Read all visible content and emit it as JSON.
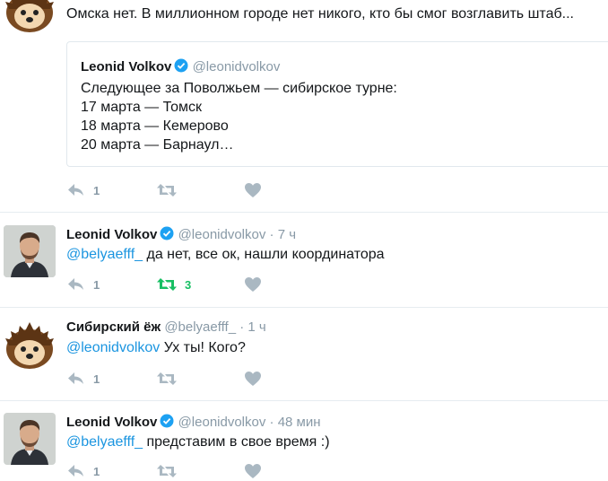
{
  "tweets": [
    {
      "text": "Омска нет. В миллионном городе нет никого, кто бы смог возглавить штаб...",
      "quote": {
        "name": "Leonid Volkov",
        "handle": "@leonidvolkov",
        "lines": [
          "Следующее за Поволжьем — сибирское турне:",
          "17 марта — Томск",
          "18 марта — Кемерово",
          "20 марта — Барнаул…"
        ]
      },
      "reply_count": "1",
      "retweet_count": "",
      "retweeted": false
    },
    {
      "name": "Leonid Volkov",
      "handle": "@leonidvolkov",
      "time": "· 7 ч",
      "mention": "@belyaefff_",
      "text": " да нет, все ок, нашли координатора",
      "reply_count": "1",
      "retweet_count": "3",
      "retweeted": true
    },
    {
      "name": "Сибирский ёж",
      "handle": "@belyaefff_",
      "time": "· 1 ч",
      "mention": "@leonidvolkov",
      "text": " Ух ты! Кого?",
      "reply_count": "1",
      "retweet_count": "",
      "retweeted": false
    },
    {
      "name": "Leonid Volkov",
      "handle": "@leonidvolkov",
      "time": "· 48 мин",
      "mention": "@belyaefff_",
      "text": " представим в свое время :)",
      "reply_count": "1",
      "retweet_count": "",
      "retweeted": false
    }
  ],
  "icons": [
    "reply-icon",
    "retweet-icon",
    "like-icon",
    "verified-icon"
  ],
  "colors": {
    "link": "#1b95e0",
    "muted": "#8899a6",
    "retweet_active": "#17bf63",
    "verified": "#1da1f2"
  }
}
